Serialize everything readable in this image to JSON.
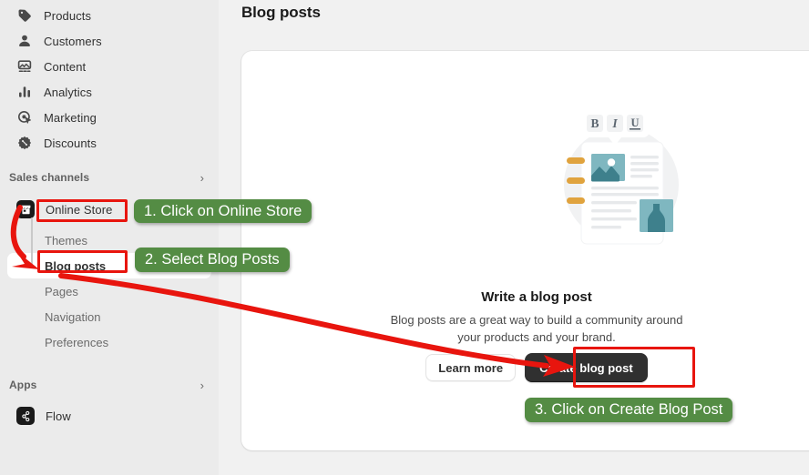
{
  "sidebar": {
    "nav_items": [
      {
        "label": "Products",
        "icon": "tag-icon"
      },
      {
        "label": "Customers",
        "icon": "person-icon"
      },
      {
        "label": "Content",
        "icon": "content-icon"
      },
      {
        "label": "Analytics",
        "icon": "bar-chart-icon"
      },
      {
        "label": "Marketing",
        "icon": "target-icon"
      },
      {
        "label": "Discounts",
        "icon": "discount-badge-icon"
      }
    ],
    "sales_channels": {
      "title": "Sales channels",
      "chevron": "›",
      "channel": {
        "label": "Online Store",
        "icon": "online-store-icon"
      },
      "sub_items": [
        {
          "label": "Themes",
          "selected": false
        },
        {
          "label": "Blog posts",
          "selected": true
        },
        {
          "label": "Pages",
          "selected": false
        },
        {
          "label": "Navigation",
          "selected": false
        },
        {
          "label": "Preferences",
          "selected": false
        }
      ]
    },
    "apps": {
      "title": "Apps",
      "chevron": "›",
      "items": [
        {
          "label": "Flow",
          "icon": "flow-icon"
        }
      ]
    }
  },
  "main": {
    "page_title": "Blog posts",
    "empty_state": {
      "heading": "Write a blog post",
      "description": "Blog posts are a great way to build a community around your products and your brand.",
      "secondary_button": "Learn more",
      "primary_button": "Create blog post",
      "illustration": {
        "name": "blog-post-illustration",
        "toolbar_buttons": [
          "B",
          "I",
          "U"
        ]
      }
    }
  },
  "annotations": {
    "accent_red": "#E8150E",
    "badge_green": "#548C44",
    "steps": [
      {
        "id": 1,
        "text": "1. Click on Online Store",
        "target": "Online Store"
      },
      {
        "id": 2,
        "text": "2. Select Blog Posts",
        "target": "Blog posts"
      },
      {
        "id": 3,
        "text": "3. Click on Create Blog Post",
        "target": "Create blog post"
      }
    ]
  },
  "colors": {
    "sidebar_bg": "#EBEBEB",
    "main_bg": "#F1F1F1",
    "card_bg": "#FFFFFF",
    "primary_button_bg": "#303030",
    "illustration_teal": "#4A8B94",
    "illustration_orange": "#E0A33E"
  }
}
